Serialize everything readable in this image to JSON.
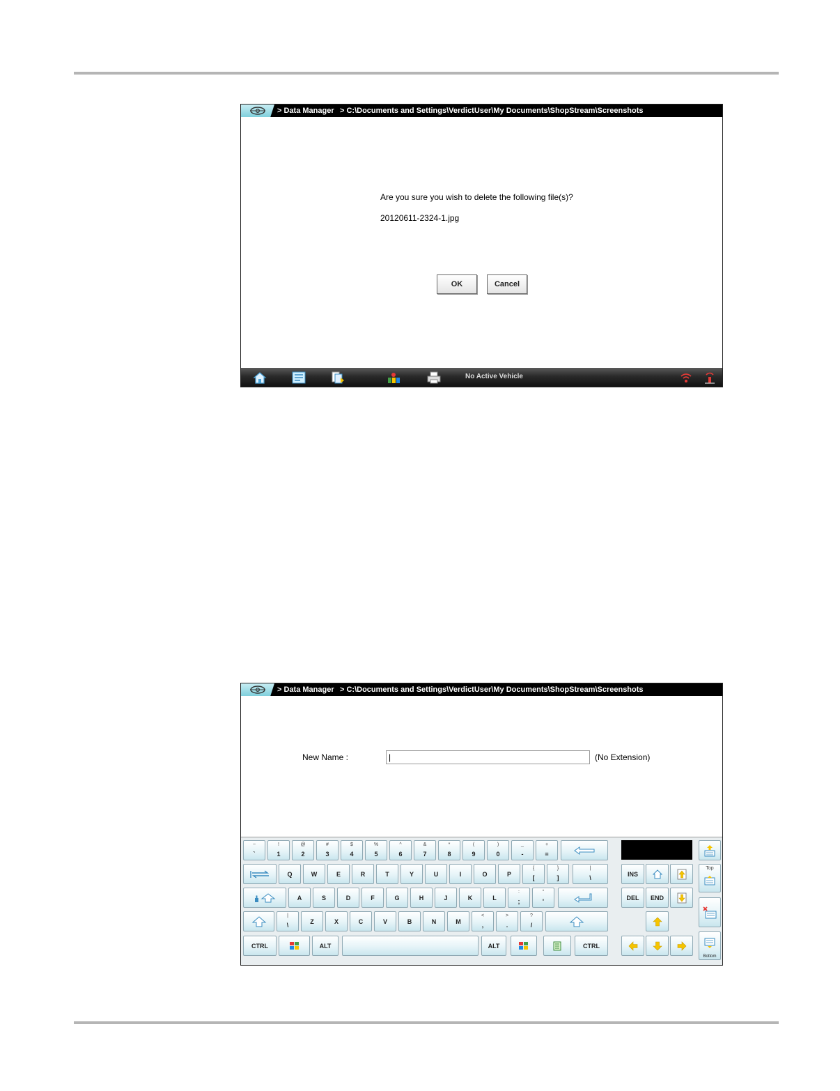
{
  "screen1": {
    "title": {
      "section": "> Data Manager",
      "path": "> C:\\Documents and Settings\\VerdictUser\\My Documents\\ShopStream\\Screenshots"
    },
    "dialog": {
      "message": "Are you sure you wish to delete the following file(s)?",
      "filename": "20120611-2324-1.jpg",
      "ok_label": "OK",
      "cancel_label": "Cancel"
    },
    "taskbar": {
      "status": "No Active Vehicle",
      "icons": [
        "home-icon",
        "toolbar-icon",
        "data-manager-icon",
        "vehicle-icon",
        "print-icon",
        "wifi-icon",
        "signal-icon"
      ]
    }
  },
  "screen2": {
    "title": {
      "section": "> Data Manager",
      "path": "> C:\\Documents and Settings\\VerdictUser\\My Documents\\ShopStream\\Screenshots"
    },
    "rename": {
      "label": "New Name :",
      "value": "|",
      "extension_note": "(No Extension)"
    },
    "keyboard": {
      "row1": [
        {
          "shift": "~",
          "main": "`"
        },
        {
          "shift": "!",
          "main": "1"
        },
        {
          "shift": "@",
          "main": "2"
        },
        {
          "shift": "#",
          "main": "3"
        },
        {
          "shift": "$",
          "main": "4"
        },
        {
          "shift": "%",
          "main": "5"
        },
        {
          "shift": "^",
          "main": "6"
        },
        {
          "shift": "&",
          "main": "7"
        },
        {
          "shift": "*",
          "main": "8"
        },
        {
          "shift": "(",
          "main": "9"
        },
        {
          "shift": ")",
          "main": "0"
        },
        {
          "shift": "_",
          "main": "-"
        },
        {
          "shift": "+",
          "main": "="
        }
      ],
      "row2": [
        "Q",
        "W",
        "E",
        "R",
        "T",
        "Y",
        "U",
        "I",
        "O",
        "P"
      ],
      "row2_brackets": [
        {
          "shift": "{",
          "main": "["
        },
        {
          "shift": "}",
          "main": "]"
        },
        {
          "shift": "|",
          "main": "\\"
        }
      ],
      "row3": [
        "A",
        "S",
        "D",
        "F",
        "G",
        "H",
        "J",
        "K",
        "L"
      ],
      "row3_punct": [
        {
          "shift": ":",
          "main": ";"
        },
        {
          "shift": "\"",
          "main": "'"
        }
      ],
      "row4_first": {
        "shift": "|",
        "main": "\\"
      },
      "row4": [
        "Z",
        "X",
        "C",
        "V",
        "B",
        "N",
        "M"
      ],
      "row4_punct": [
        {
          "shift": "<",
          "main": ","
        },
        {
          "shift": ">",
          "main": "."
        },
        {
          "shift": "?",
          "main": "/"
        }
      ],
      "ctrl_label": "CTRL",
      "alt_label": "ALT",
      "ins_label": "INS",
      "del_label": "DEL",
      "end_label": "END",
      "top_label": "Top",
      "bottom_label": "Bottom"
    }
  },
  "colors": {
    "title_bg": "#000000",
    "key_face": "#e6f4f8",
    "key_border": "#8fa9b4",
    "arrow_yellow": "#f5c400"
  }
}
